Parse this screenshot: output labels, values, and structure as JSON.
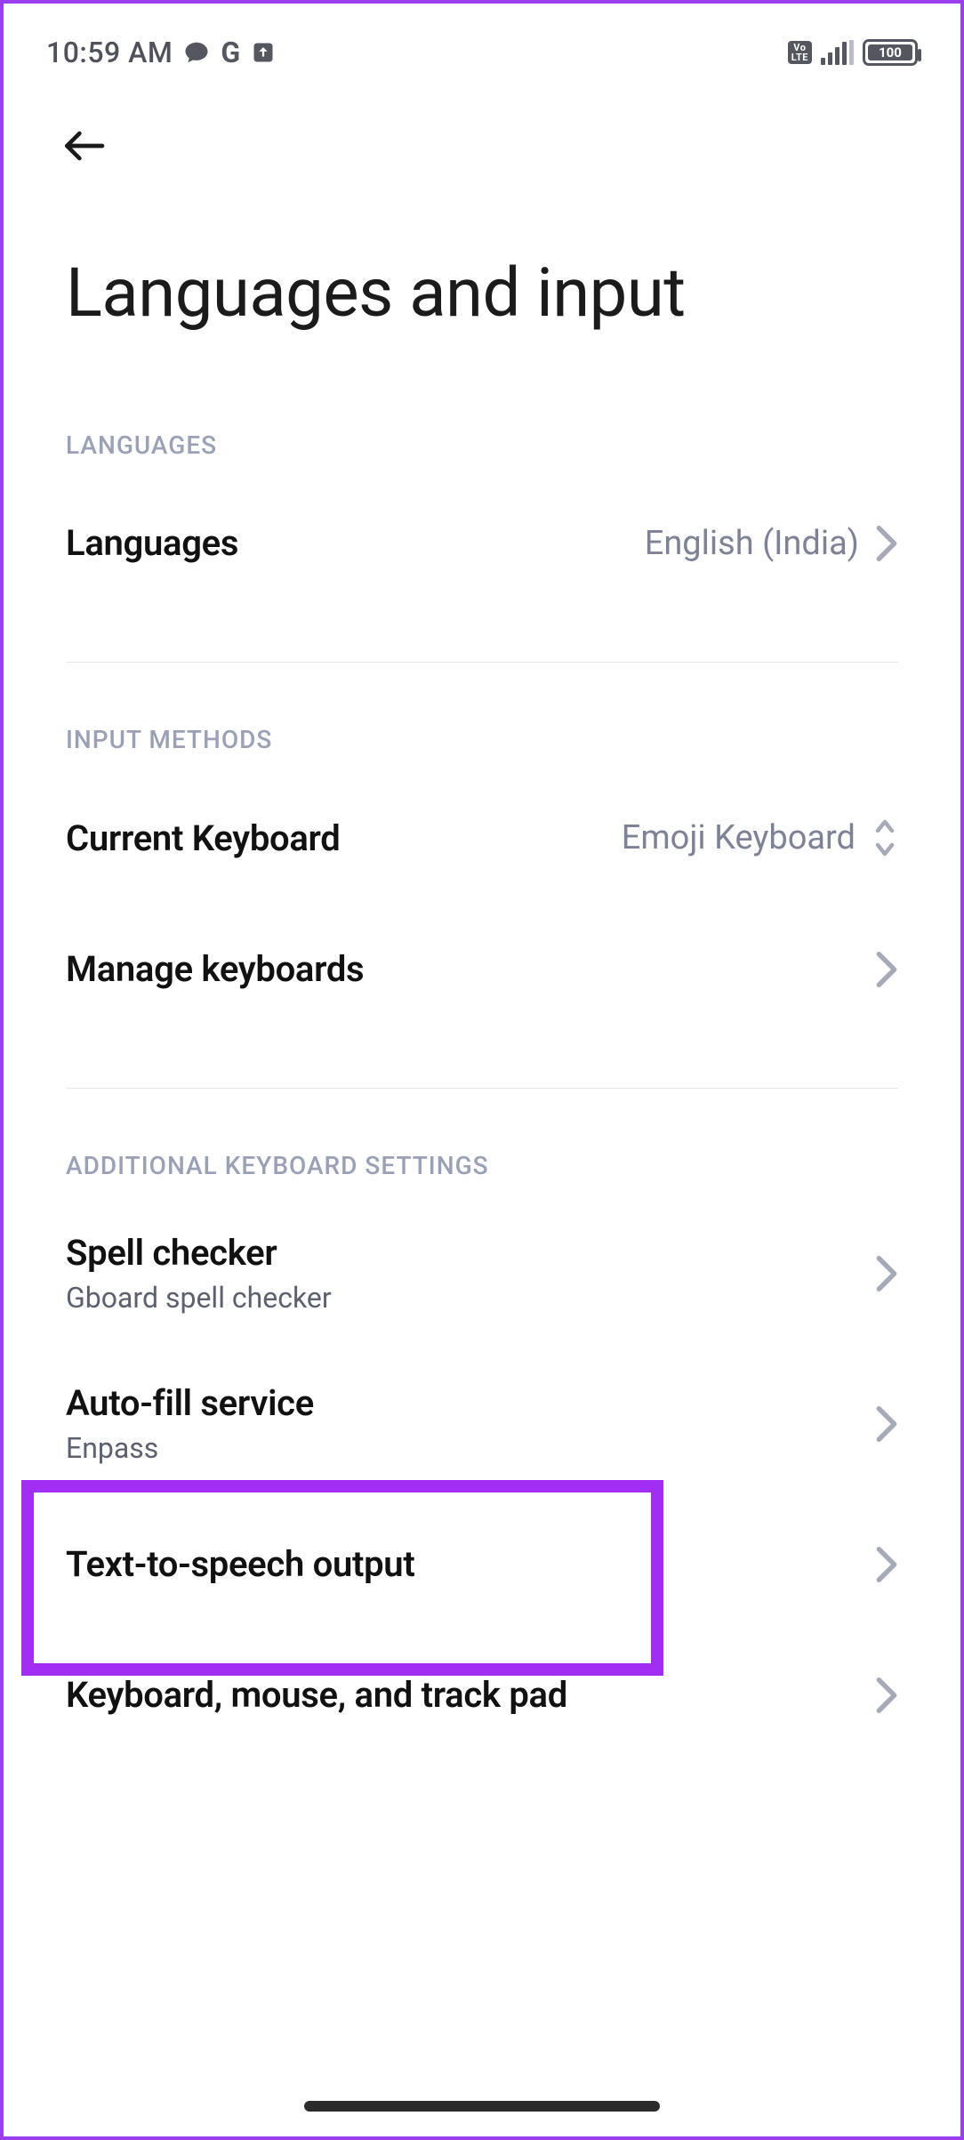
{
  "status": {
    "time": "10:59 AM",
    "battery_text": "100"
  },
  "header": {
    "title": "Languages and input"
  },
  "sections": {
    "languages": {
      "header": "LANGUAGES",
      "items": {
        "languages_row": {
          "title": "Languages",
          "value": "English (India)"
        }
      }
    },
    "input_methods": {
      "header": "INPUT METHODS",
      "items": {
        "current_keyboard": {
          "title": "Current Keyboard",
          "value": "Emoji Keyboard"
        },
        "manage_keyboards": {
          "title": "Manage keyboards"
        }
      }
    },
    "additional": {
      "header": "ADDITIONAL KEYBOARD SETTINGS",
      "items": {
        "spell_checker": {
          "title": "Spell checker",
          "sub": "Gboard spell checker"
        },
        "autofill": {
          "title": "Auto-fill service",
          "sub": "Enpass"
        },
        "tts": {
          "title": "Text-to-speech output"
        },
        "keyboard_mouse": {
          "title": "Keyboard, mouse, and track pad"
        }
      }
    }
  }
}
